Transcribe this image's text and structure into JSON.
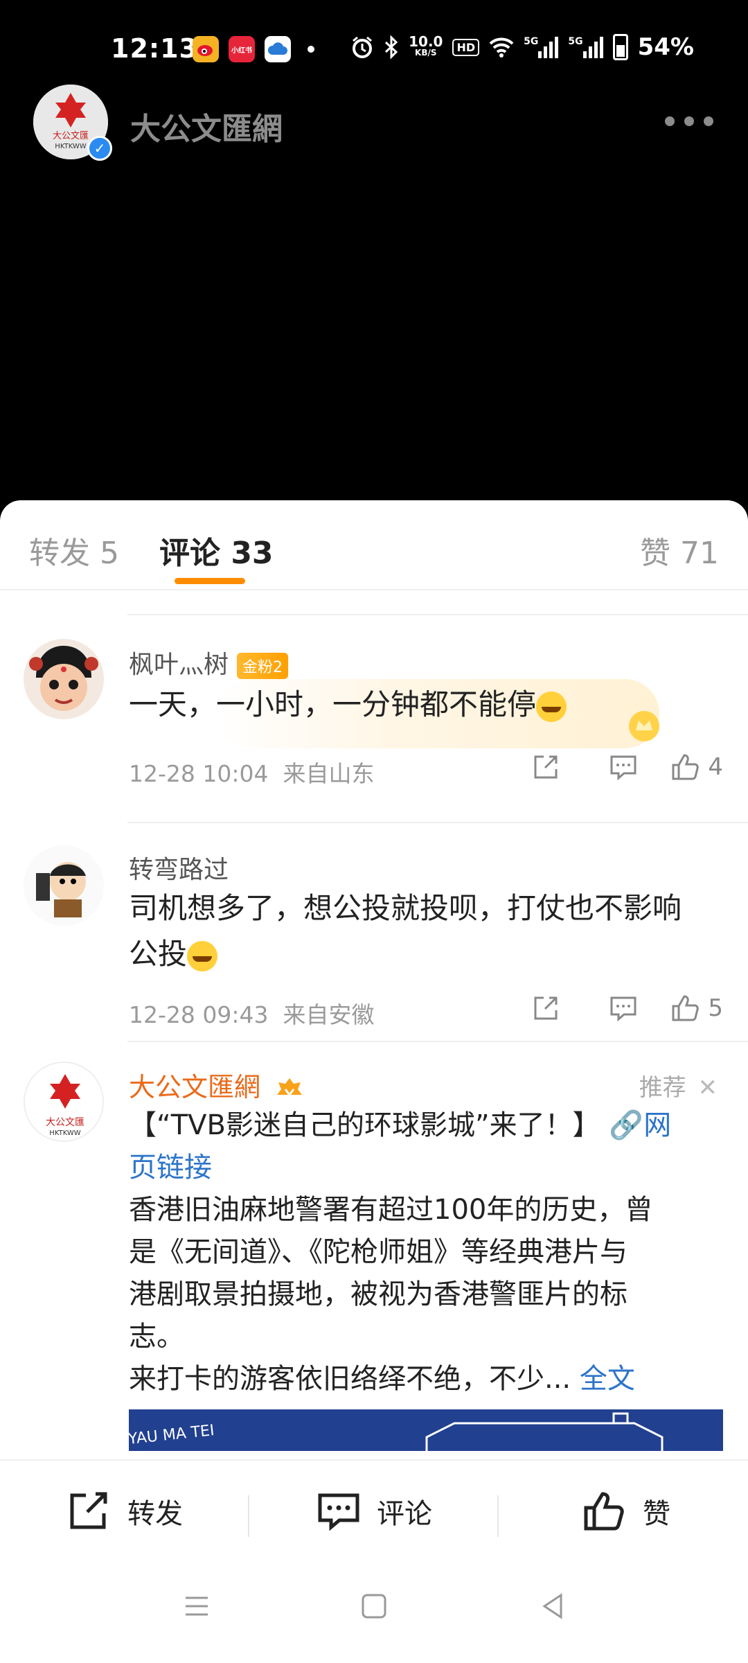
{
  "status_bar": {
    "time": "12:13",
    "apps": [
      {
        "icon": "weibo-icon",
        "color": "#f5b324",
        "label": ""
      },
      {
        "icon": "xiaohongshu-icon",
        "color": "#e6243a",
        "label": "小红书"
      },
      {
        "icon": "cloud-app-icon",
        "color": "#2a7bd6",
        "label": ""
      }
    ],
    "net_speed": "10.0",
    "net_unit": "KB/S",
    "hd_label": "HD",
    "net_5g_1": "5G",
    "net_5g_2": "5G",
    "battery": "54%"
  },
  "header": {
    "account_name": "大公文匯網",
    "logo_text": "大公文匯",
    "logo_sub": "HKTKWW"
  },
  "tabs": {
    "repost": "转发 5",
    "comment": "评论 33",
    "like": "赞 71"
  },
  "comments": [
    {
      "user": "枫叶灬树",
      "badge": "金粉2",
      "text": "一天，一小时，一分钟都不能停",
      "time": "12-28 10:04",
      "location": "来自山东",
      "likes": "4"
    },
    {
      "user": "转弯路过",
      "text_line1": "司机想多了，想公投就投呗，打仗也不影响",
      "text_line2": "公投",
      "time": "12-28 09:43",
      "location": "来自安徽",
      "likes": "5"
    }
  ],
  "recommended": {
    "user": "大公文匯網",
    "flag": "推荐",
    "headline": "【“TVB影迷自己的环球影城”来了！】",
    "link_prefix": "网",
    "link_suffix": "页链接",
    "body_1": "香港旧油麻地警署有超过100年的历史，曾",
    "body_2": "是《无间道》、《陀枪师姐》等经典港片与",
    "body_3": "港剧取景拍摄地，被视为香港警匪片的标",
    "body_4": "志。",
    "body_5": "来打卡的游客依旧络绎不绝，不少...",
    "full_text": "全文",
    "image_text": "YAU MA TEI"
  },
  "bottom_bar": {
    "repost": "转发",
    "comment": "评论",
    "like": "赞"
  },
  "colors": {
    "accent_orange": "#ff8c00",
    "link_blue": "#2d74c9",
    "name_orange": "#e96b1c"
  }
}
